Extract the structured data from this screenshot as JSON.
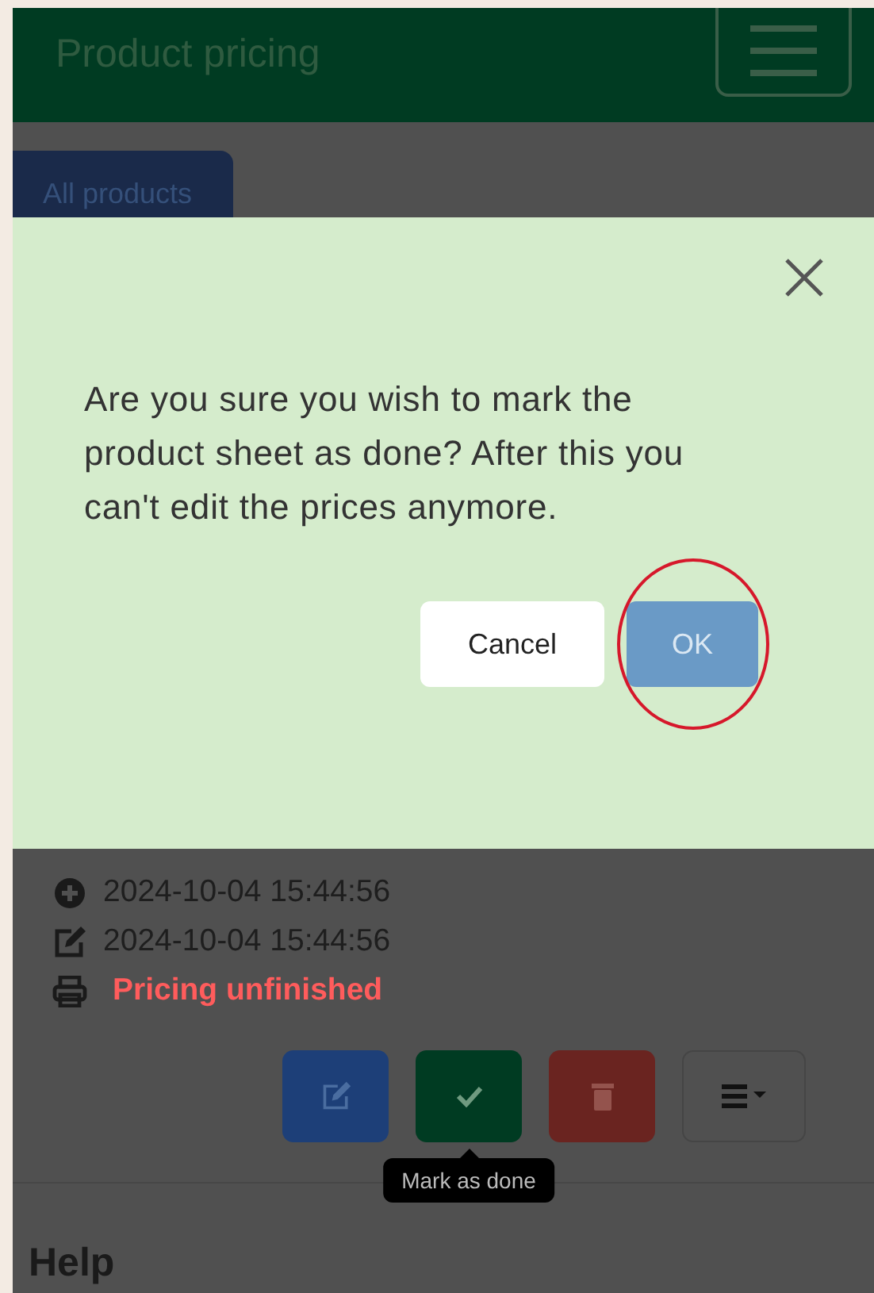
{
  "header": {
    "title": "Product pricing"
  },
  "tabs": [
    {
      "label": "All products",
      "selected": true
    }
  ],
  "dialog": {
    "message": "Are you sure you wish to mark the product sheet as done? After this you can't edit the prices anymore.",
    "buttons": [
      {
        "label": "Cancel",
        "kind": "secondary",
        "highlighted": false
      },
      {
        "label": "OK",
        "kind": "primary",
        "highlighted": true
      }
    ]
  },
  "details": [
    {
      "kind": "created",
      "text": "2024-10-04 15:44:56"
    },
    {
      "kind": "edited",
      "text": "2024-10-04 15:44:56"
    },
    {
      "kind": "status",
      "text": "Pricing unfinished"
    }
  ],
  "actions": [
    {
      "kind": "edit"
    },
    {
      "kind": "done",
      "tooltip": "Mark as done"
    },
    {
      "kind": "delete"
    },
    {
      "kind": "menu"
    }
  ],
  "help": {
    "title": "Help"
  }
}
